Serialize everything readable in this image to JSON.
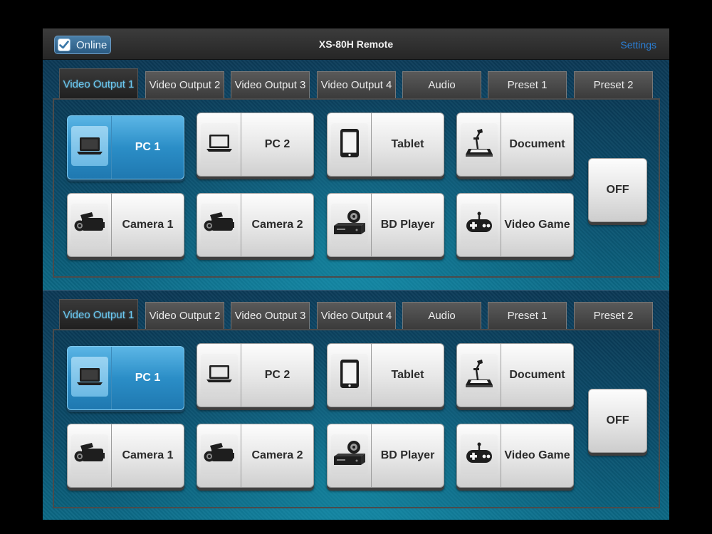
{
  "titlebar": {
    "online_label": "Online",
    "title": "XS-80H Remote",
    "settings_label": "Settings"
  },
  "panels": [
    {
      "tabs": [
        "Video Output 1",
        "Video Output 2",
        "Video Output 3",
        "Video Output 4",
        "Audio",
        "Preset 1",
        "Preset 2"
      ],
      "active_tab": "Video Output 1",
      "sources": [
        "PC 1",
        "PC 2",
        "Tablet",
        "Document",
        "Camera 1",
        "Camera 2",
        "BD Player",
        "Video Game"
      ],
      "active_source": "PC 1",
      "off_label": "OFF"
    },
    {
      "tabs": [
        "Video Output 1",
        "Video Output 2",
        "Video Output 3",
        "Video Output 4",
        "Audio",
        "Preset 1",
        "Preset 2"
      ],
      "active_tab": "Video Output 1",
      "sources": [
        "PC 1",
        "PC 2",
        "Tablet",
        "Document",
        "Camera 1",
        "Camera 2",
        "BD Player",
        "Video Game"
      ],
      "active_source": "PC 1",
      "off_label": "OFF"
    }
  ],
  "icons": [
    "laptop-icon",
    "laptop-icon",
    "tablet-icon",
    "document-camera-icon",
    "camcorder-icon",
    "camcorder-icon",
    "bd-player-icon",
    "gamepad-icon"
  ],
  "colors": {
    "accent": "#2b8ec7",
    "active_tab_text": "#6cc9f2",
    "settings_link": "#2a7fd6"
  }
}
